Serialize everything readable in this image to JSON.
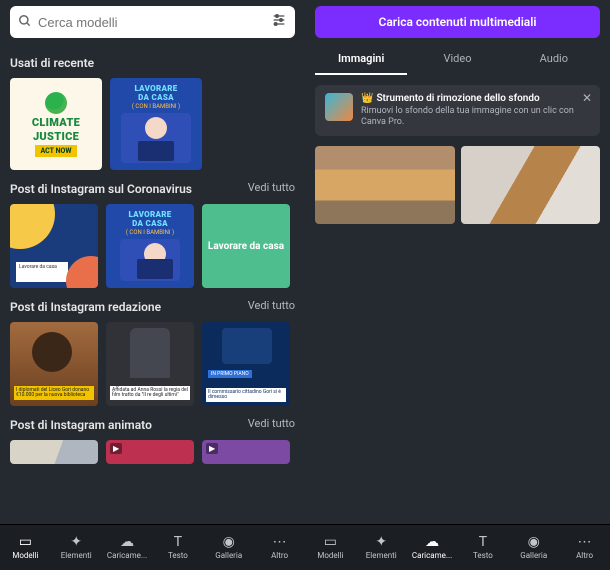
{
  "left": {
    "search": {
      "placeholder": "Cerca modelli"
    },
    "sections": {
      "recent": {
        "title": "Usati di recente",
        "climate": {
          "line1": "CLIMATE",
          "line2": "JUSTICE",
          "badge": "ACT NOW"
        },
        "lavorare": {
          "line1": "LAVORARE",
          "line2": "DA CASA",
          "line3": "( CON I BAMBINI )"
        }
      },
      "corona": {
        "title": "Post di Instagram sul Coronavirus",
        "see_all": "Vedi tutto",
        "abstract_label": "Lavorare\nda casa",
        "lavorare": {
          "line1": "LAVORARE",
          "line2": "DA CASA",
          "line3": "( CON I BAMBINI )"
        },
        "green": "Lavorare\nda casa"
      },
      "redazione": {
        "title": "Post di Instagram redazione",
        "see_all": "Vedi tutto",
        "card1": "I diplomati del Liceo Gori donano €10.000 per la nuova biblioteca",
        "card2": "Affidata ad Anna Rossi la regia del film tratto da \"Il re degli ultimi\"",
        "card3_tag": "IN PRIMO PIANO",
        "card3": "Il commissario cittadino Gori si è dimesso"
      },
      "animato": {
        "title": "Post di Instagram animato",
        "see_all": "Vedi tutto"
      }
    },
    "nav": {
      "items": [
        {
          "label": "Modelli"
        },
        {
          "label": "Elementi"
        },
        {
          "label": "Caricame..."
        },
        {
          "label": "Testo"
        },
        {
          "label": "Galleria"
        },
        {
          "label": "Altro"
        }
      ]
    }
  },
  "right": {
    "upload_button": "Carica contenuti multimediali",
    "tabs": {
      "images": "Immagini",
      "video": "Video",
      "audio": "Audio"
    },
    "banner": {
      "title": "Strumento di rimozione dello sfondo",
      "desc": "Rimuovi lo sfondo della tua immagine con un clic con Canva Pro."
    },
    "nav": {
      "items": [
        {
          "label": "Modelli"
        },
        {
          "label": "Elementi"
        },
        {
          "label": "Caricame..."
        },
        {
          "label": "Testo"
        },
        {
          "label": "Galleria"
        },
        {
          "label": "Altro"
        }
      ]
    }
  }
}
